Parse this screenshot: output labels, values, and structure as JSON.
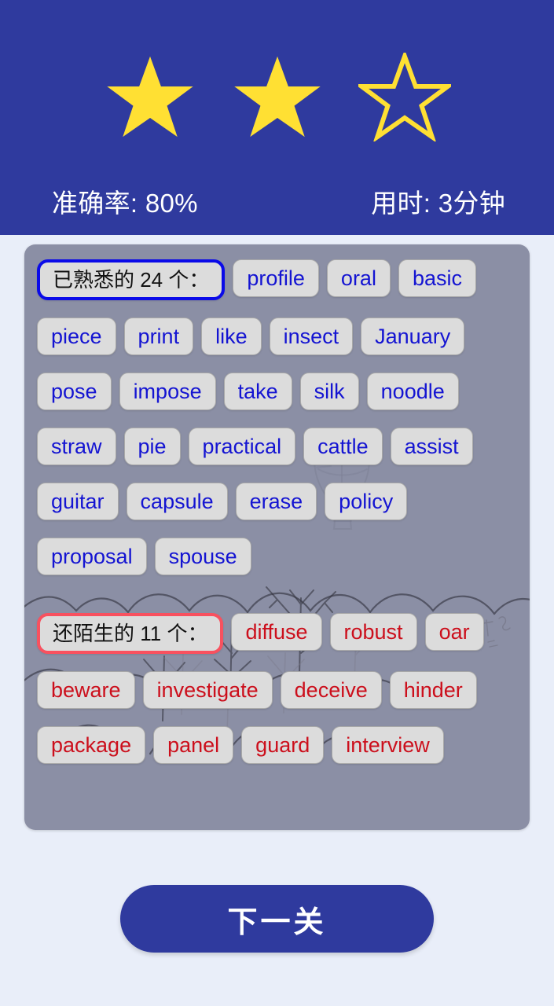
{
  "header": {
    "stars": {
      "total": 3,
      "filled": 2,
      "icon": "star-icon",
      "filled_color": "#ffe033",
      "empty_color": "#ffe033"
    },
    "background_color": "#2f3a9e",
    "accuracy_text": "准确率: 80%",
    "time_text": "用时: 3分钟"
  },
  "panel": {
    "background_color": "#8b8fa5",
    "known": {
      "label": "已熟悉的 24 个：",
      "border_color": "#0a0ae8",
      "text_color": "#1414d2",
      "count": 24,
      "words": [
        "profile",
        "oral",
        "basic",
        "piece",
        "print",
        "like",
        "insect",
        "January",
        "pose",
        "impose",
        "take",
        "silk",
        "noodle",
        "straw",
        "pie",
        "practical",
        "cattle",
        "assist",
        "guitar",
        "capsule",
        "erase",
        "policy",
        "proposal",
        "spouse"
      ],
      "row_breaks": [
        3,
        8,
        13,
        18,
        22
      ]
    },
    "unknown": {
      "label": "还陌生的 11 个：",
      "border_color": "#f8515f",
      "text_color": "#cc0f1c",
      "count": 11,
      "words": [
        "diffuse",
        "robust",
        "oar",
        "beware",
        "investigate",
        "deceive",
        "hinder",
        "package",
        "panel",
        "guard",
        "interview"
      ],
      "row_breaks": [
        3,
        7
      ]
    }
  },
  "footer": {
    "next_label": "下一关",
    "next_color": "#2f3a9e"
  }
}
